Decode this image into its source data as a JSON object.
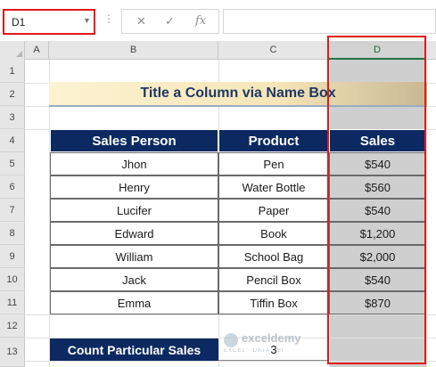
{
  "formula_bar": {
    "name_box": "D1",
    "cancel_icon": "✕",
    "enter_icon": "✓",
    "fx_label": "fx",
    "formula": ""
  },
  "columns": [
    "A",
    "B",
    "C",
    "D"
  ],
  "rows": [
    "1",
    "2",
    "3",
    "4",
    "5",
    "6",
    "7",
    "8",
    "9",
    "10",
    "11",
    "12",
    "13"
  ],
  "title": "Title a Column via Name Box",
  "table": {
    "headers": [
      "Sales Person",
      "Product",
      "Sales"
    ],
    "rows": [
      [
        "Jhon",
        "Pen",
        "$540"
      ],
      [
        "Henry",
        "Water Bottle",
        "$560"
      ],
      [
        "Lucifer",
        "Paper",
        "$540"
      ],
      [
        "Edward",
        "Book",
        "$1,200"
      ],
      [
        "William",
        "School Bag",
        "$2,000"
      ],
      [
        "Jack",
        "Pencil Box",
        "$540"
      ],
      [
        "Emma",
        "Tiffin Box",
        "$870"
      ]
    ]
  },
  "count": {
    "label": "Count Particular Sales",
    "value": "3"
  },
  "watermark": {
    "brand": "exceldemy",
    "tagline": "EXCEL · DATA · BI"
  },
  "colors": {
    "header_fill": "#0c2a61",
    "selection": "#cfcfcf",
    "highlight_border": "#e0191b",
    "title_text": "#1f3864"
  }
}
